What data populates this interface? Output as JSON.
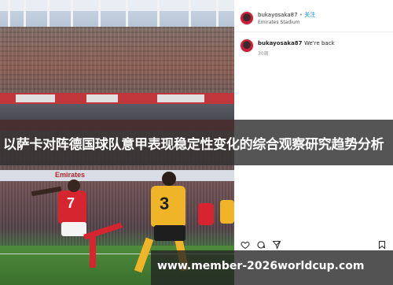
{
  "post": {
    "username": "bukayosaka87",
    "dot": "•",
    "follow": "关注",
    "location": "Emirates Stadium",
    "stadium_board": "Emirates",
    "comment": {
      "username": "bukayosaka87",
      "text": "We're back",
      "time": "30周"
    },
    "players": {
      "left_number": "7",
      "right_number": "3"
    }
  },
  "banner": {
    "headline": "以萨卡对阵德国球队意甲表现稳定性变化的综合观察研究趋势分析"
  },
  "watermark": {
    "url": "www.member-2026worldcup.com"
  },
  "icons": [
    "heart-icon",
    "comment-icon",
    "share-icon",
    "bookmark-icon"
  ],
  "colors": {
    "arsenal_red": "#d6252e",
    "wolves_gold": "#f0b428",
    "follow_blue": "#0095f6"
  }
}
